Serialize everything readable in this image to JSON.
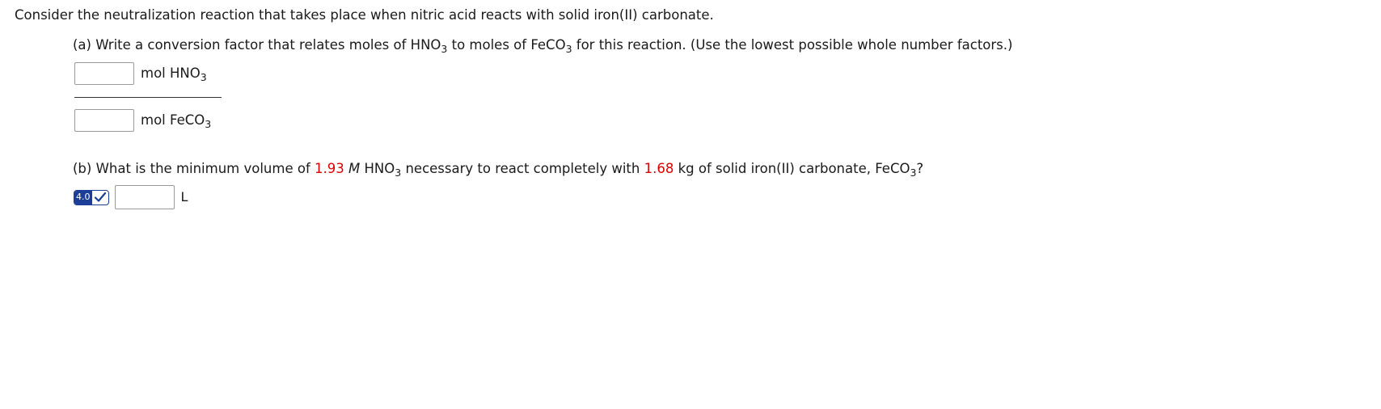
{
  "intro": "Consider the neutralization reaction that takes place when nitric acid reacts with solid iron(II) carbonate.",
  "part_a": {
    "prefix": "(a) Write a conversion factor that relates moles of ",
    "formula1_main": "HNO",
    "formula1_sub": "3",
    "middle": " to moles of ",
    "formula2_main": "FeCO",
    "formula2_sub": "3",
    "suffix": " for this reaction. (Use the lowest possible whole number factors.)",
    "numerator": {
      "value": "",
      "unit_prefix": "mol ",
      "unit_main": "HNO",
      "unit_sub": "3"
    },
    "denominator": {
      "value": "",
      "unit_prefix": "mol ",
      "unit_main": "FeCO",
      "unit_sub": "3"
    }
  },
  "part_b": {
    "prefix": "(b) What is the minimum volume of ",
    "concentration": "1.93",
    "molarity_symbol": "M",
    "acid_main": "HNO",
    "acid_sub": "3",
    "middle": " necessary to react completely with ",
    "mass": "1.68",
    "after_mass": " kg of solid iron(II) carbonate, ",
    "carbonate_main": "FeCO",
    "carbonate_sub": "3",
    "end": "?",
    "sigfig_badge": "4.0",
    "answer_value": "",
    "unit": "L"
  },
  "colors": {
    "highlight_red": "#e00000",
    "badge_blue": "#1b3f98"
  },
  "icons": {
    "sigfig_check": "checkmark-icon"
  }
}
